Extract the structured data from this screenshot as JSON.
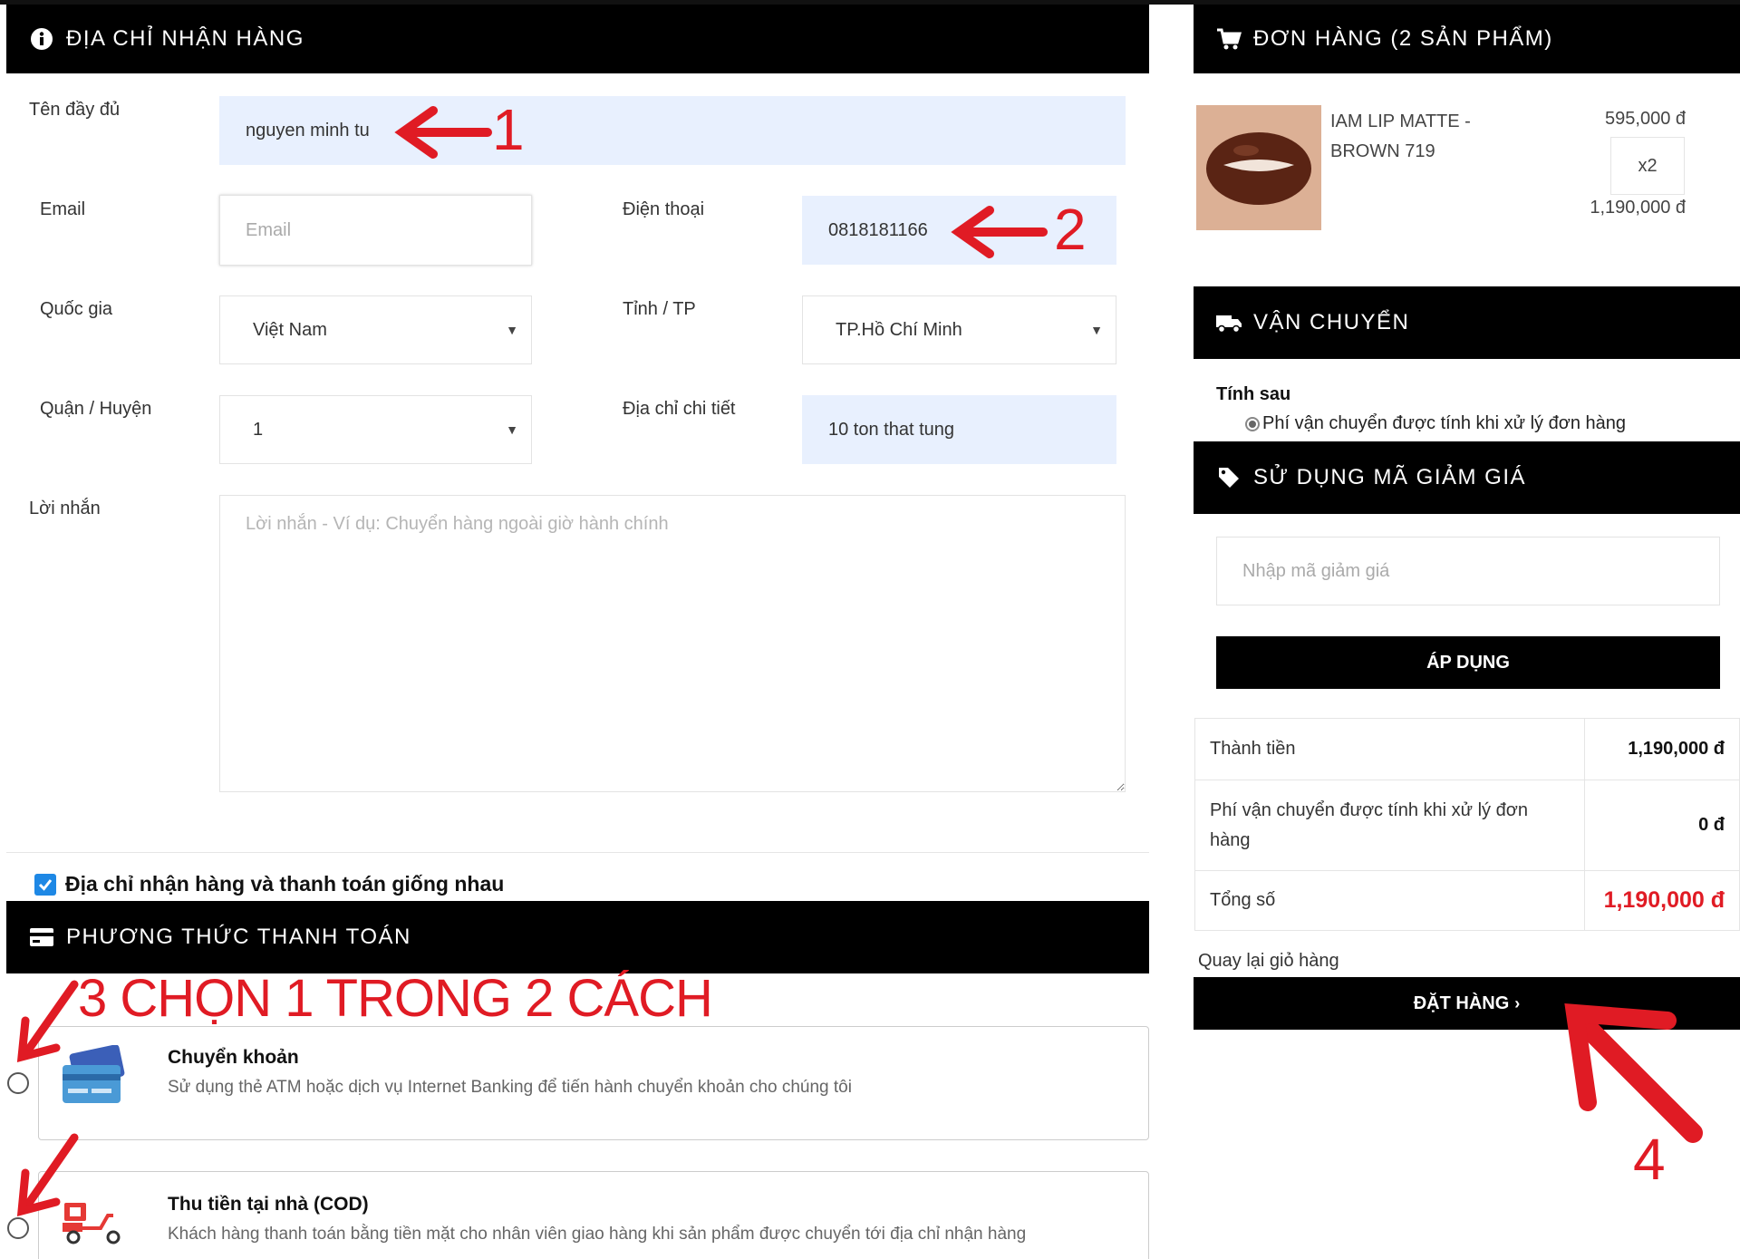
{
  "shipping_address": {
    "title": "ĐỊA CHỈ NHẬN HÀNG",
    "full_name_label": "Tên đầy đủ",
    "full_name_value": "nguyen minh tu",
    "email_label": "Email",
    "email_placeholder": "Email",
    "phone_label": "Điện thoại",
    "phone_value": "0818181166",
    "country_label": "Quốc gia",
    "country_value": "Việt Nam",
    "province_label": "Tỉnh / TP",
    "province_value": "TP.Hồ Chí Minh",
    "district_label": "Quận / Huyện",
    "district_value": "1",
    "address_label": "Địa chỉ chi tiết",
    "address_value": "10 ton that tung",
    "message_label": "Lời nhắn",
    "message_placeholder": "Lời nhắn - Ví dụ: Chuyển hàng ngoài giờ hành chính",
    "same_address_label": "Địa chỉ nhận hàng và thanh toán giống nhau"
  },
  "payment": {
    "title": "PHƯƠNG THỨC THANH TOÁN",
    "options": [
      {
        "title": "Chuyển khoản",
        "desc": "Sử dụng thẻ ATM hoặc dịch vụ Internet Banking để tiến hành chuyển khoản cho chúng tôi"
      },
      {
        "title": "Thu tiền tại nhà (COD)",
        "desc": "Khách hàng thanh toán bằng tiền mặt cho nhân viên giao hàng khi sản phẩm được chuyển tới địa chỉ nhận hàng"
      }
    ]
  },
  "order": {
    "title": "ĐƠN HÀNG (2 SẢN PHẨM)",
    "item_name_line1": "IAM LIP MATTE -",
    "item_name_line2": "BROWN 719",
    "item_price": "595,000 đ",
    "item_qty": "x2",
    "item_total": "1,190,000 đ"
  },
  "shipping": {
    "title": "VẬN CHUYỂN",
    "method_title": "Tính sau",
    "method_option": "Phí vận chuyển được tính khi xử lý đơn hàng"
  },
  "discount": {
    "title": "SỬ DỤNG MÃ GIẢM GIÁ",
    "placeholder": "Nhập mã giảm giá",
    "apply_label": "ÁP DỤNG"
  },
  "summary": {
    "subtotal_label": "Thành tiền",
    "subtotal_value": "1,190,000 đ",
    "shipping_label_line1": "Phí vận chuyển được tính khi xử lý đơn",
    "shipping_label_line2": "hàng",
    "shipping_value": "0 đ",
    "total_label": "Tổng số",
    "total_value": "1,190,000 đ",
    "back_link": "Quay lại giỏ hàng",
    "order_button": "ĐẶT HÀNG"
  },
  "annotations": {
    "a1": "1",
    "a2": "2",
    "a3": "3 CHỌN 1 TRONG 2 CÁCH",
    "a4": "4"
  },
  "colors": {
    "accent_red": "#e01b24",
    "header_black": "#000000",
    "autofill_blue": "#e8f0fe"
  },
  "icons": [
    "info-icon",
    "cart-icon",
    "truck-icon",
    "tag-icon",
    "credit-card-icon",
    "bank-card-icon",
    "delivery-scooter-icon",
    "chevron-right-icon"
  ]
}
